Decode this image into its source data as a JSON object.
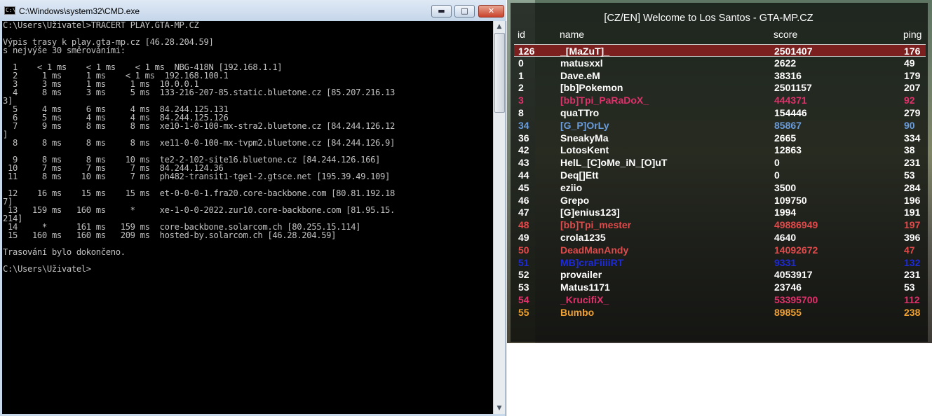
{
  "cmd": {
    "title": "C:\\Windows\\system32\\CMD.exe",
    "icon_text": "C:\\",
    "buttons": {
      "minimize": "▬",
      "maximize": "□",
      "close": "✕"
    },
    "console_lines": [
      "C:\\Users\\Uživatel>TRACERT PLAY.GTA-MP.CZ",
      "",
      "Výpis trasy k play.gta-mp.cz [46.28.204.59]",
      "s nejvýše 30 směrováními:",
      "",
      "  1    < 1 ms    < 1 ms    < 1 ms  NBG-418N [192.168.1.1]",
      "  2     1 ms     1 ms    < 1 ms  192.168.100.1",
      "  3     3 ms     1 ms     1 ms  10.0.0.1",
      "  4     8 ms     3 ms     5 ms  133-216-207-85.static.bluetone.cz [85.207.216.13",
      "3]",
      "  5     4 ms     6 ms     4 ms  84.244.125.131",
      "  6     5 ms     4 ms     4 ms  84.244.125.126",
      "  7     9 ms     8 ms     8 ms  xe10-1-0-100-mx-stra2.bluetone.cz [84.244.126.12",
      "]",
      "  8     8 ms     8 ms     8 ms  xe11-0-0-100-mx-tvpm2.bluetone.cz [84.244.126.9]",
      "",
      "  9     8 ms     8 ms    10 ms  te2-2-102-site16.bluetone.cz [84.244.126.166]",
      " 10     7 ms     7 ms     7 ms  84.244.124.36",
      " 11     8 ms    10 ms     7 ms  ph482-transit1-tge1-2.gtsce.net [195.39.49.109]",
      "",
      " 12    16 ms    15 ms    15 ms  et-0-0-0-1.fra20.core-backbone.com [80.81.192.18",
      "7]",
      " 13   159 ms   160 ms     *     xe-1-0-0-2022.zur10.core-backbone.com [81.95.15.",
      "214]",
      " 14     *      161 ms   159 ms  core-backbone.solarcom.ch [80.255.15.114]",
      " 15   160 ms   160 ms   209 ms  hosted-by.solarcom.ch [46.28.204.59]",
      "",
      "Trasování bylo dokončeno.",
      "",
      "C:\\Users\\Uživatel>"
    ],
    "scrollbar": {
      "up": "▲",
      "down": "▼"
    }
  },
  "scoreboard": {
    "title": "[CZ/EN] Welcome to Los Santos - GTA-MP.CZ",
    "columns": {
      "id": "id",
      "name": "name",
      "score": "score",
      "ping": "ping"
    },
    "players": [
      {
        "id": "126",
        "name": "_[MaZuT]_",
        "score": "2501407",
        "ping": "176",
        "color": "#ffffff",
        "selected": true
      },
      {
        "id": "0",
        "name": "matusxxl",
        "score": "2622",
        "ping": "49",
        "color": "#ffffff"
      },
      {
        "id": "1",
        "name": "Dave.eM",
        "score": "38316",
        "ping": "179",
        "color": "#ffffff"
      },
      {
        "id": "2",
        "name": "[bb]Pokemon",
        "score": "2501157",
        "ping": "207",
        "color": "#ffffff"
      },
      {
        "id": "3",
        "name": "[bb]Tpi_PaRaDoX_",
        "score": "444371",
        "ping": "92",
        "color": "#e0306c"
      },
      {
        "id": "8",
        "name": "quaTTro",
        "score": "154446",
        "ping": "279",
        "color": "#ffffff"
      },
      {
        "id": "34",
        "name": "[G_P]OrLy",
        "score": "85867",
        "ping": "90",
        "color": "#6a9cdc"
      },
      {
        "id": "36",
        "name": "SneakyMa",
        "score": "2665",
        "ping": "334",
        "color": "#ffffff"
      },
      {
        "id": "42",
        "name": "LotosKent",
        "score": "12863",
        "ping": "38",
        "color": "#ffffff"
      },
      {
        "id": "43",
        "name": "HelL_[C]oMe_iN_[O]uT",
        "score": "0",
        "ping": "231",
        "color": "#ffffff"
      },
      {
        "id": "44",
        "name": "Deq[]Ett",
        "score": "0",
        "ping": "53",
        "color": "#ffffff"
      },
      {
        "id": "45",
        "name": "eziio",
        "score": "3500",
        "ping": "284",
        "color": "#ffffff"
      },
      {
        "id": "46",
        "name": "Grepo",
        "score": "109750",
        "ping": "196",
        "color": "#ffffff"
      },
      {
        "id": "47",
        "name": "[G]enius123]",
        "score": "1994",
        "ping": "191",
        "color": "#ffffff"
      },
      {
        "id": "48",
        "name": "[bb]Tpi_mester",
        "score": "49886949",
        "ping": "197",
        "color": "#e04a4a"
      },
      {
        "id": "49",
        "name": "crola1235",
        "score": "4640",
        "ping": "396",
        "color": "#ffffff"
      },
      {
        "id": "50",
        "name": "DeadManAndy",
        "score": "14092672",
        "ping": "47",
        "color": "#e04a4a"
      },
      {
        "id": "51",
        "name": "MB]craFiiiiRT",
        "score": "9331",
        "ping": "132",
        "color": "#1c2ad8"
      },
      {
        "id": "52",
        "name": "provailer",
        "score": "4053917",
        "ping": "231",
        "color": "#ffffff"
      },
      {
        "id": "53",
        "name": "Matus1171",
        "score": "23746",
        "ping": "53",
        "color": "#ffffff"
      },
      {
        "id": "54",
        "name": "_KrucifiX_",
        "score": "53395700",
        "ping": "112",
        "color": "#e0306c"
      },
      {
        "id": "55",
        "name": "Bumbo",
        "score": "89855",
        "ping": "238",
        "color": "#f0a030"
      }
    ]
  }
}
